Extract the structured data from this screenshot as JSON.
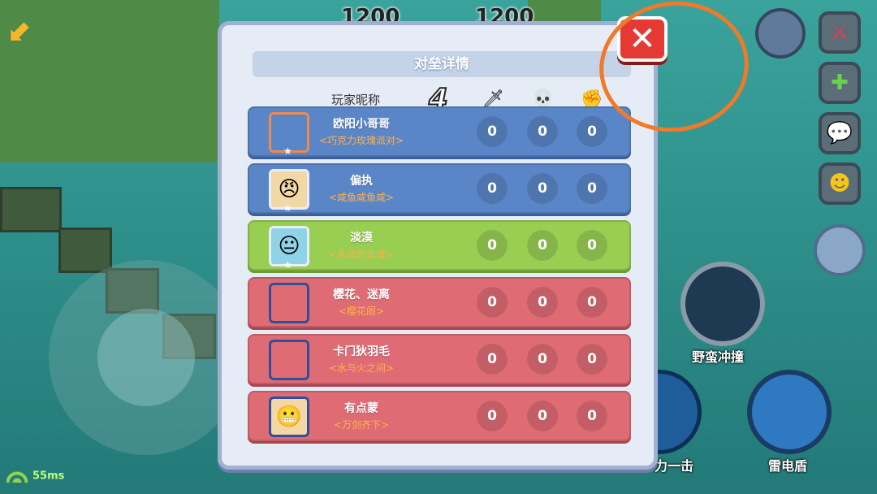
{
  "hud": {
    "score_left": "1200",
    "score_right": "1200",
    "ping": "55ms",
    "skills": [
      {
        "label": "野蛮冲撞"
      },
      {
        "label": "力一击"
      },
      {
        "label": "雷电盾"
      }
    ]
  },
  "panel": {
    "title": "对垒详情",
    "header": {
      "name_col": "玩家昵称",
      "count": "4",
      "icons": [
        "sword-icon",
        "skull-icon",
        "fist-icon"
      ]
    },
    "players": [
      {
        "name": "欧阳小哥哥",
        "guild": "<巧克力玫瑰派对>",
        "team": "blue",
        "kills": "0",
        "deaths": "0",
        "assists": "0"
      },
      {
        "name": "偏执",
        "guild": "<咸鱼咸鱼咸>",
        "team": "blue",
        "kills": "0",
        "deaths": "0",
        "assists": "0"
      },
      {
        "name": "淡漠",
        "guild": "<永远的友谊>",
        "team": "green",
        "kills": "0",
        "deaths": "0",
        "assists": "0"
      },
      {
        "name": "樱花、迷离",
        "guild": "<樱花阁>",
        "team": "red",
        "kills": "0",
        "deaths": "0",
        "assists": "0"
      },
      {
        "name": "卡门狄羽毛",
        "guild": "<水与火之间>",
        "team": "red",
        "kills": "0",
        "deaths": "0",
        "assists": "0"
      },
      {
        "name": "有点蒙",
        "guild": "<万剑齐下>",
        "team": "red",
        "kills": "0",
        "deaths": "0",
        "assists": "0"
      }
    ]
  },
  "colors": {
    "blue_team": "#5a86c8",
    "green_team": "#98cf52",
    "red_team": "#df6c75",
    "close_button": "#e53a34",
    "annotation": "#f07a2a"
  }
}
